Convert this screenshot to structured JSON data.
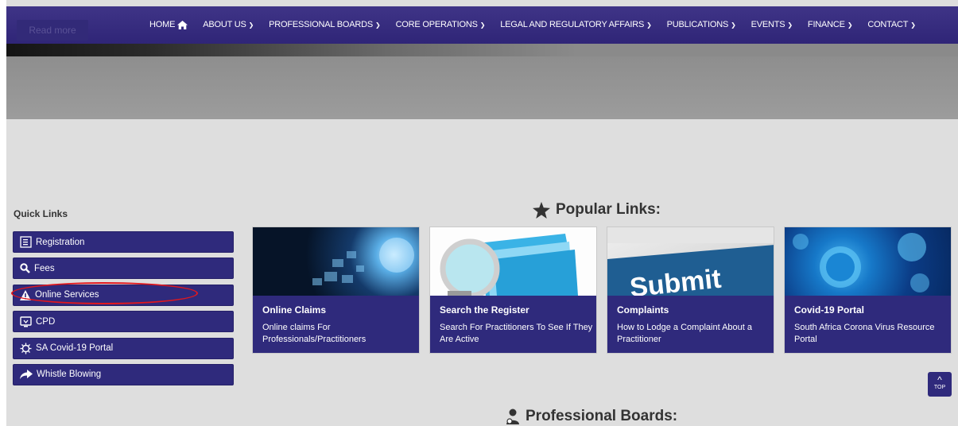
{
  "nav": {
    "read_more": "Read more",
    "items": [
      {
        "label": "HOME",
        "icon": "home-icon"
      },
      {
        "label": "ABOUT US",
        "icon": "chevron-down-icon"
      },
      {
        "label": "PROFESSIONAL BOARDS",
        "icon": "chevron-down-icon"
      },
      {
        "label": "CORE OPERATIONS",
        "icon": "chevron-down-icon"
      },
      {
        "label": "LEGAL AND REGULATORY AFFAIRS",
        "icon": "chevron-down-icon"
      },
      {
        "label": "PUBLICATIONS",
        "icon": "chevron-down-icon"
      },
      {
        "label": "EVENTS",
        "icon": "chevron-down-icon"
      },
      {
        "label": "FINANCE",
        "icon": "chevron-down-icon"
      },
      {
        "label": "CONTACT",
        "icon": "chevron-down-icon"
      }
    ]
  },
  "quick_links": {
    "title": "Quick Links",
    "items": [
      {
        "label": "Registration",
        "icon": "document-icon"
      },
      {
        "label": "Fees",
        "icon": "search-icon"
      },
      {
        "label": "Online Services",
        "icon": "warning-icon"
      },
      {
        "label": "CPD",
        "icon": "monitor-icon"
      },
      {
        "label": "SA Covid-19 Portal",
        "icon": "virus-icon"
      },
      {
        "label": "Whistle Blowing",
        "icon": "share-arrow-icon"
      }
    ]
  },
  "popular": {
    "title": "Popular Links:",
    "cards": [
      {
        "title": "Online Claims",
        "desc": "Online claims For Professionals/Practitioners"
      },
      {
        "title": "Search the Register",
        "desc": "Search For Practitioners To See If They Are Active"
      },
      {
        "title": "Complaints",
        "desc": "How to Lodge a Complaint About a Practitioner"
      },
      {
        "title": "Covid-19 Portal",
        "desc": "South Africa Corona Virus Resource Portal"
      }
    ]
  },
  "complaints_image_text": "Submit",
  "top_button": "TOP",
  "boards": {
    "title": "Professional Boards:"
  },
  "colors": {
    "primary": "#2f2a7c",
    "nav": "#3a3084",
    "highlight": "#e0181e",
    "background": "#dedede"
  }
}
